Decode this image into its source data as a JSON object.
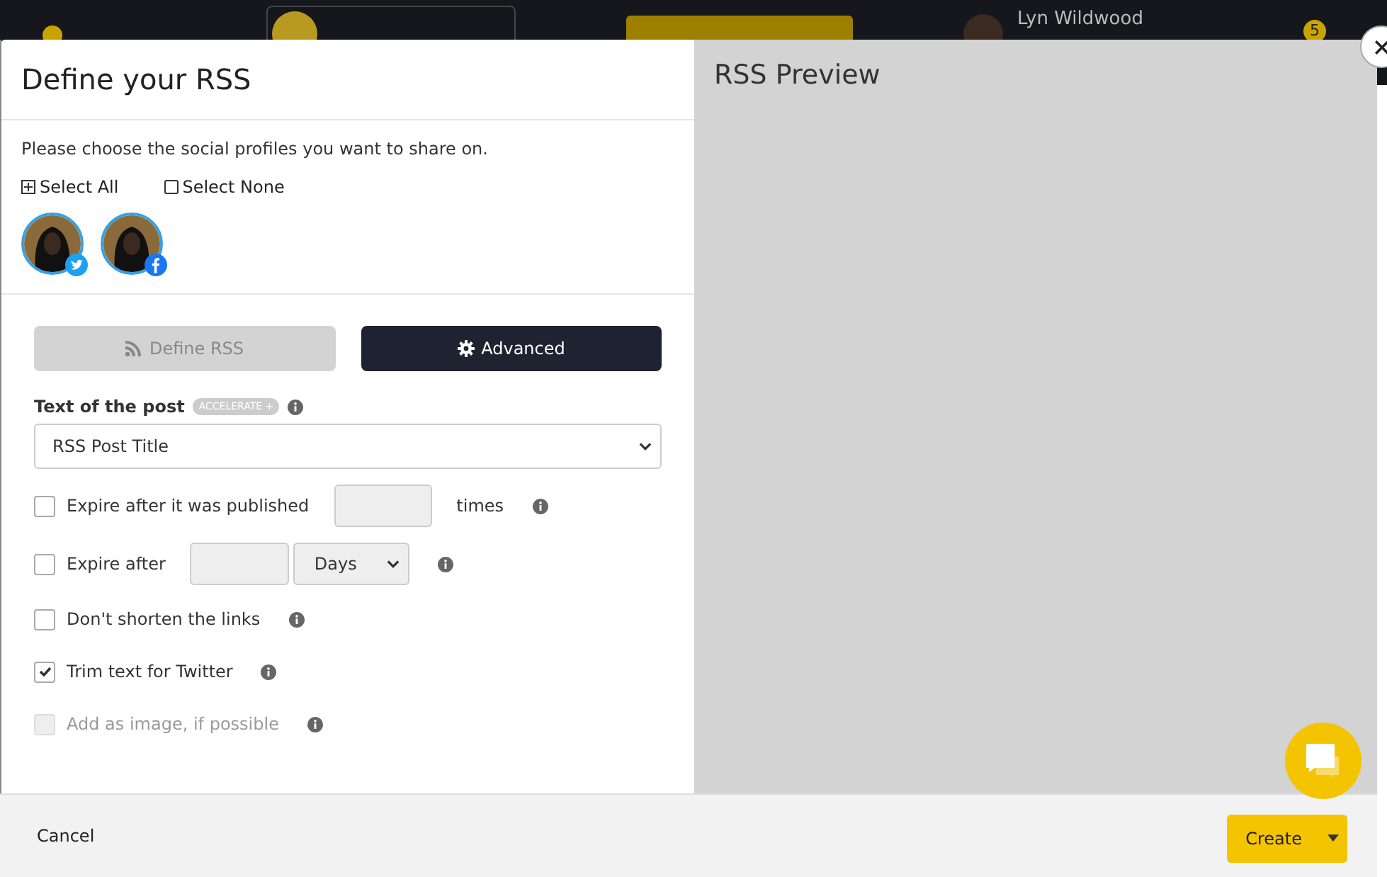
{
  "topbar": {
    "user": "Lyn Wildwood",
    "notifications": "5"
  },
  "modal": {
    "title": "Define your RSS",
    "intro": "Please choose the social profiles you want to share on.",
    "select_all": "Select All",
    "select_none": "Select None",
    "profiles": [
      {
        "kind": "twitter",
        "selected": true
      },
      {
        "kind": "facebook",
        "selected": true
      }
    ],
    "tabs": [
      {
        "label": "Define RSS",
        "selected": false
      },
      {
        "label": "Advanced",
        "selected": true
      }
    ],
    "text_of_post": {
      "label": "Text of the post",
      "badge": "ACCELERATE +",
      "value": "RSS Post Title"
    },
    "options": [
      {
        "kind": "count",
        "label": "Expire after it was published",
        "checked": false,
        "disabled": false,
        "suffix": "times"
      },
      {
        "kind": "period",
        "label": "Expire after",
        "checked": false,
        "disabled": false,
        "unit": "Days"
      },
      {
        "kind": "plain",
        "label": "Don't shorten the links",
        "checked": false,
        "disabled": false
      },
      {
        "kind": "plain",
        "label": "Trim text for Twitter",
        "checked": true,
        "disabled": false
      },
      {
        "kind": "plain",
        "label": "Add as image, if possible",
        "checked": false,
        "disabled": true
      }
    ],
    "preview_title": "RSS Preview",
    "cancel": "Cancel",
    "create": "Create"
  }
}
